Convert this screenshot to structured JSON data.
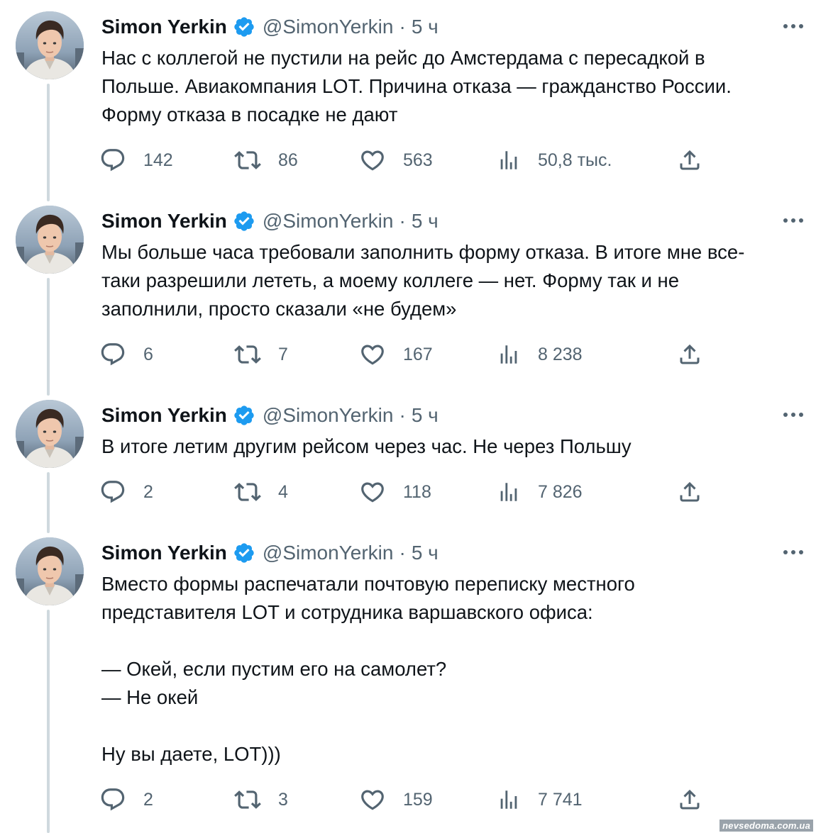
{
  "user": {
    "name": "Simon Yerkin",
    "handle": "@SimonYerkin",
    "separator": "·"
  },
  "tweets": [
    {
      "time": "5 ч",
      "text": "Нас с коллегой не пустили на рейс до Амстердама с пересадкой в\nПольше. Авиакомпания LOT. Причина отказа — гражданство России.\nФорму отказа в посадке не дают",
      "replies": "142",
      "retweets": "86",
      "likes": "563",
      "views": "50,8 тыс."
    },
    {
      "time": "5 ч",
      "text": "Мы больше часа требовали заполнить форму отказа. В итоге мне все-\nтаки разрешили лететь, а моему коллеге — нет. Форму так и не\nзаполнили, просто сказали «не будем»",
      "replies": "6",
      "retweets": "7",
      "likes": "167",
      "views": "8 238"
    },
    {
      "time": "5 ч",
      "text": "В итоге летим другим рейсом через час. Не через Польшу",
      "replies": "2",
      "retweets": "4",
      "likes": "118",
      "views": "7 826"
    },
    {
      "time": "5 ч",
      "text": "Вместо формы распечатали почтовую переписку местного\nпредставителя LOT и сотрудника варшавского офиса:\n\n— Окей, если пустим его на самолет?\n— Не окей\n\nНу вы даете, LOT)))",
      "replies": "2",
      "retweets": "3",
      "likes": "159",
      "views": "7 741"
    }
  ],
  "icons": {
    "verified": "verified-badge-icon",
    "more": "more-icon",
    "reply": "reply-icon",
    "retweet": "retweet-icon",
    "like": "heart-icon",
    "views": "views-icon",
    "share": "share-icon"
  },
  "colors": {
    "verified_blue": "#1d9bf0",
    "text_primary": "#0f1419",
    "text_secondary": "#536471",
    "thread_line": "#cfd9de"
  },
  "watermark": "nevsedoma.com.ua"
}
